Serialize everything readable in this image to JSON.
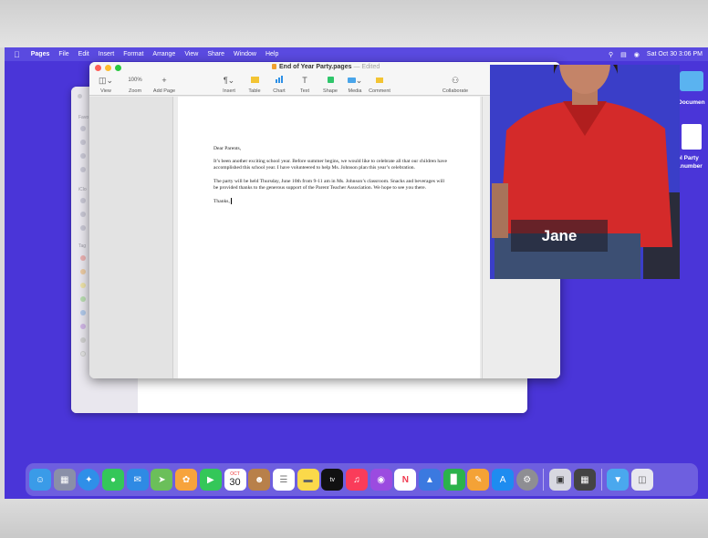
{
  "menubar": {
    "apple": "",
    "items": [
      "Pages",
      "File",
      "Edit",
      "Insert",
      "Format",
      "Arrange",
      "View",
      "Share",
      "Window",
      "Help"
    ],
    "datetime": "Sat Oct 30  3:06 PM"
  },
  "window": {
    "title": "End of Year Party.pages",
    "edited": "— Edited"
  },
  "toolbar": {
    "view": "View",
    "zoom_value": "100%",
    "zoom": "Zoom",
    "add_page": "Add Page",
    "insert": "Insert",
    "table": "Table",
    "chart": "Chart",
    "text": "Text",
    "shape": "Shape",
    "media": "Media",
    "comment": "Comment",
    "collaborate": "Collaborate"
  },
  "document": {
    "greeting": "Dear Parents,",
    "p1": "It’s been another exciting school year. Before summer begins, we would like to celebrate all that our children have accomplished this school year. I have volunteered to help Ms. Johnson plan this year’s celebration.",
    "p2": "The party will be held Thursday, June 10th from 9-11 am in Ms. Johnson’s classroom. Snacks and beverages will be provided thanks to the generous support of the Parent Teacher Association. We hope to see you there.",
    "closing": "Thanks,"
  },
  "presenter": {
    "name": "Jane"
  },
  "desktop": {
    "folder_label": "Documen",
    "file_label_1": "ol Party",
    "file_label_2": "t.number"
  },
  "calendar": {
    "month": "OCT",
    "day": "30"
  },
  "colors": {
    "desktop": "#4a35d8",
    "menubar": "#5a4ae0",
    "shirt": "#d42a2a"
  }
}
